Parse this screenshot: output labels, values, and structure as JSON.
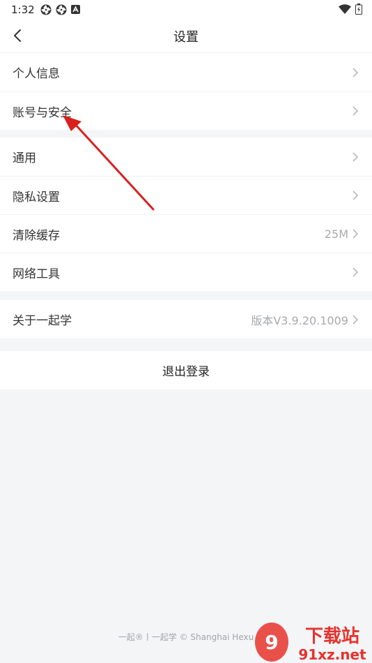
{
  "status_bar": {
    "time": "1:32"
  },
  "header": {
    "title": "设置"
  },
  "groups": [
    {
      "items": [
        {
          "label": "个人信息",
          "value": ""
        },
        {
          "label": "账号与安全",
          "value": ""
        }
      ]
    },
    {
      "items": [
        {
          "label": "通用",
          "value": ""
        },
        {
          "label": "隐私设置",
          "value": ""
        },
        {
          "label": "清除缓存",
          "value": "25M"
        },
        {
          "label": "网络工具",
          "value": ""
        }
      ]
    },
    {
      "items": [
        {
          "label": "关于一起学",
          "value": "版本V3.9.20.1009"
        }
      ]
    }
  ],
  "logout_label": "退出登录",
  "footer_text": "一起®丨一起学 © Shanghai Hexu",
  "watermark": {
    "top": "下载站",
    "bottom": "91xz.net"
  },
  "colors": {
    "background": "#f4f5f7",
    "annotation_arrow": "#d9201f",
    "watermark_red": "#e8322c"
  }
}
